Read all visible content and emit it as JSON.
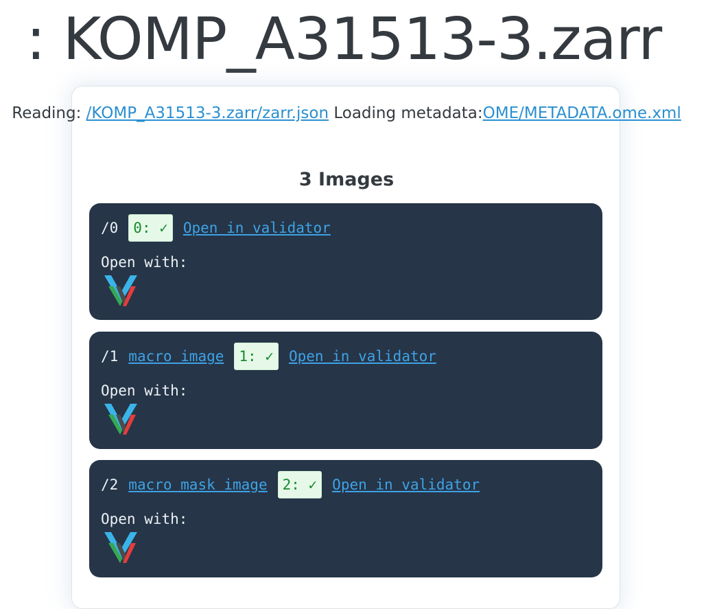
{
  "page": {
    "title": ": KOMP_A31513-3.zarr"
  },
  "reading": {
    "prefix": "Reading: ",
    "zarr_link": "/KOMP_A31513-3.zarr/zarr.json",
    "loading_text": " Loading metadata:",
    "metadata_link": "OME/METADATA.ome.xml"
  },
  "images": {
    "heading": "3 Images",
    "open_with_label": "Open with:",
    "viewer_icon": "vizarr-icon",
    "items": [
      {
        "path": "/0",
        "name": "",
        "badge": "0: ✓",
        "validator_link": "Open in validator"
      },
      {
        "path": "/1",
        "name": "macro image",
        "badge": "1: ✓",
        "validator_link": "Open in validator"
      },
      {
        "path": "/2",
        "name": "macro mask image",
        "badge": "2: ✓",
        "validator_link": "Open in validator"
      }
    ]
  },
  "colors": {
    "panel_background": "#263548",
    "link": "#2a8fd0",
    "badge_background": "#e6f9e9",
    "badge_text": "#168a2c"
  }
}
